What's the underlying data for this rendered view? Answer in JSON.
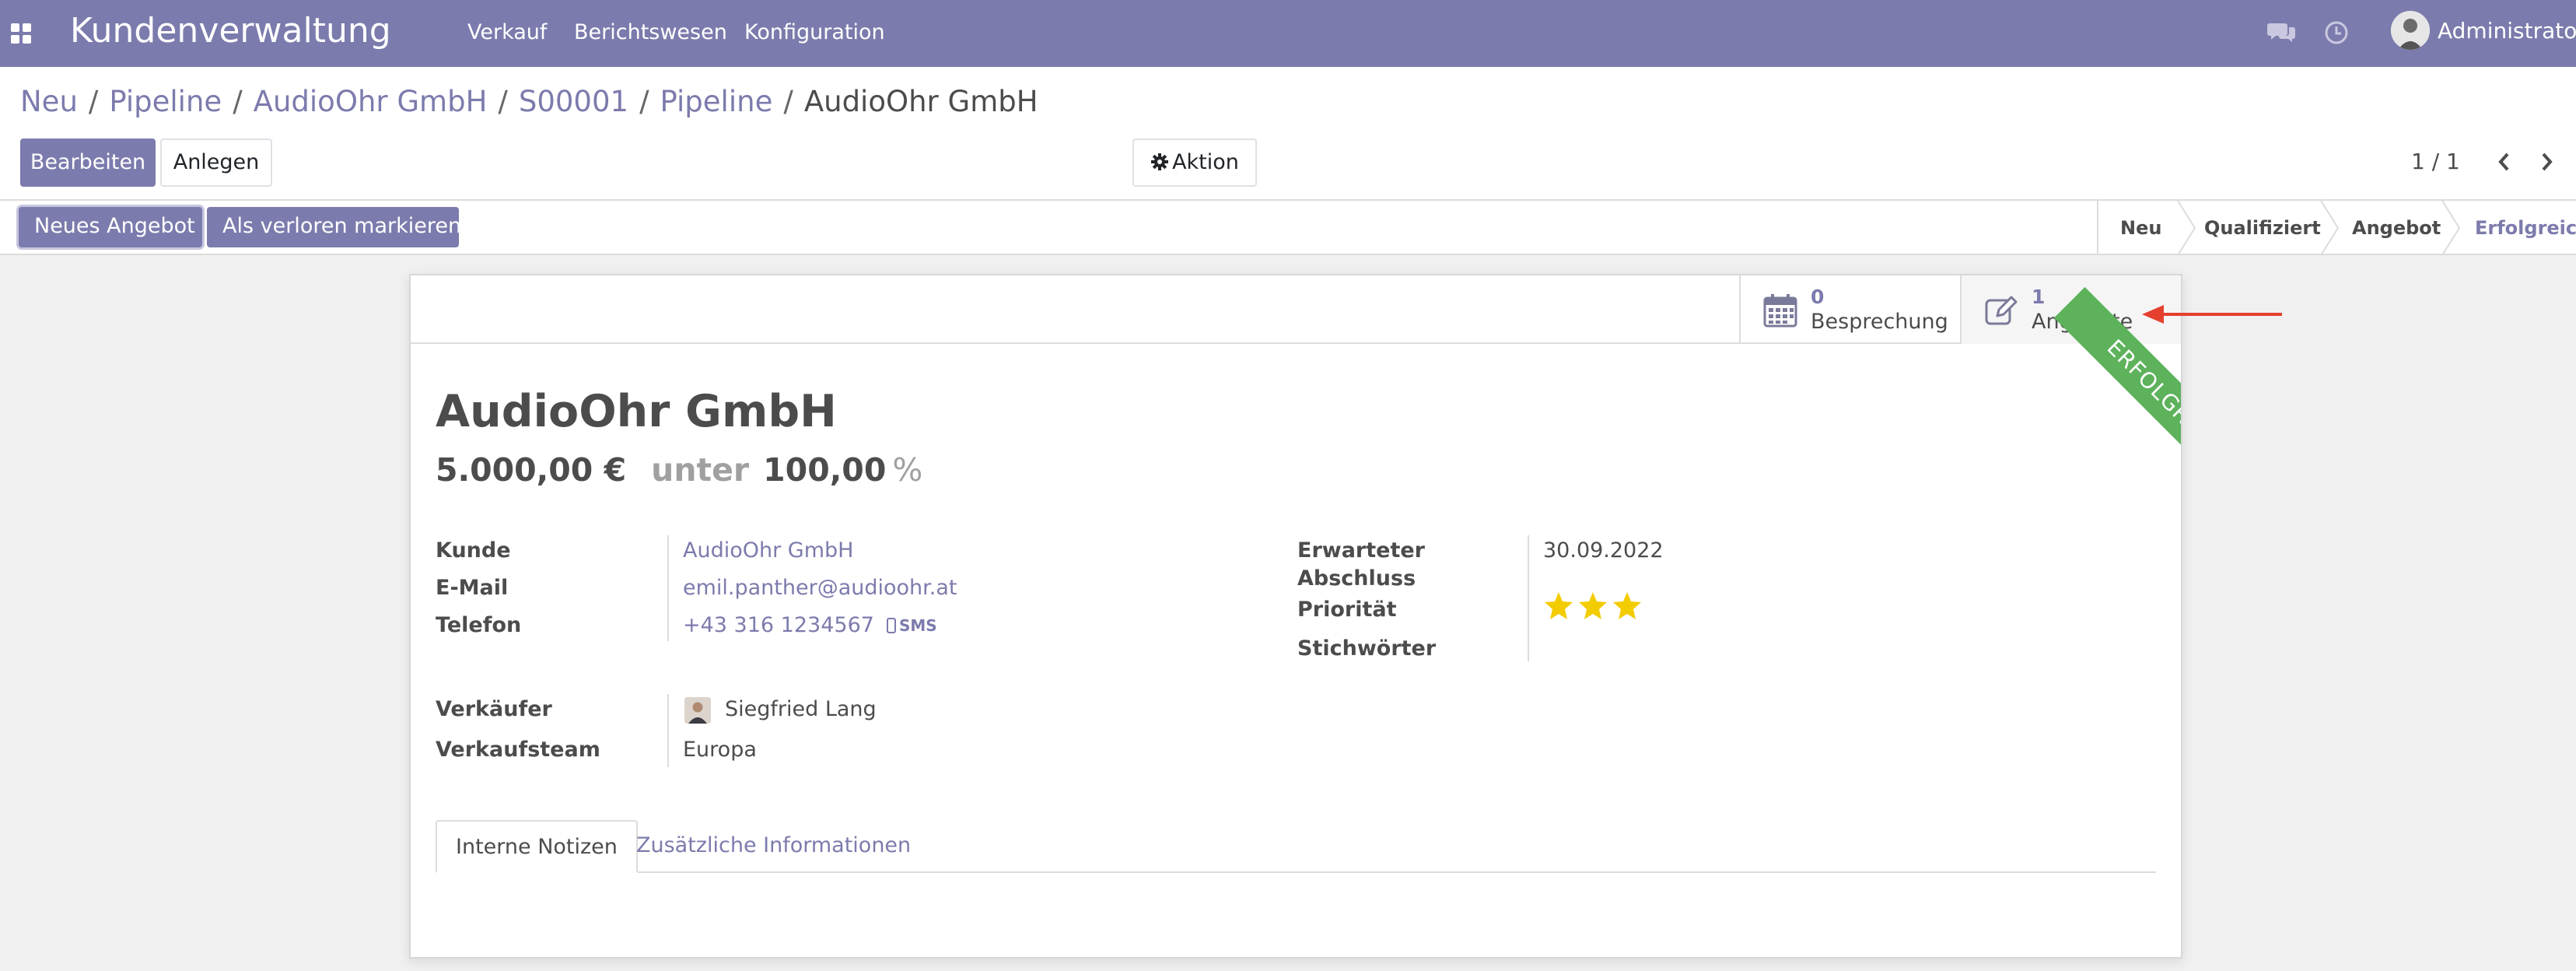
{
  "navbar": {
    "app_title": "Kundenverwaltung",
    "menu": [
      "Verkauf",
      "Berichtswesen",
      "Konfiguration"
    ],
    "user_name": "Administrator"
  },
  "breadcrumb": {
    "items": [
      "Neu",
      "Pipeline",
      "AudioOhr GmbH",
      "S00001",
      "Pipeline"
    ],
    "current": "AudioOhr GmbH",
    "separator": "/"
  },
  "toolbar": {
    "edit_label": "Bearbeiten",
    "create_label": "Anlegen",
    "action_label": "Aktion",
    "pager": "1 / 1"
  },
  "statusbar": {
    "new_quote_label": "Neues Angebot",
    "mark_lost_label": "Als verloren markieren",
    "stages": [
      {
        "label": "Neu",
        "active": false
      },
      {
        "label": "Qualifiziert",
        "active": false
      },
      {
        "label": "Angebot",
        "active": false
      },
      {
        "label": "Erfolgreich",
        "active": true
      }
    ]
  },
  "smart_buttons": {
    "meetings": {
      "count": "0",
      "label": "Besprechung"
    },
    "quotations": {
      "count": "1",
      "label": "Angebote"
    }
  },
  "ribbon": "ERFOLGREICH",
  "record": {
    "title": "AudioOhr GmbH",
    "expected_revenue": "5.000,00 €",
    "at_label": "unter",
    "probability": "100,00",
    "probability_unit": "%"
  },
  "fields_left": {
    "customer_label": "Kunde",
    "customer_value": "AudioOhr GmbH",
    "email_label": "E-Mail",
    "email_value": "emil.panther@audioohr.at",
    "phone_label": "Telefon",
    "phone_value": "+43 316 1234567",
    "sms_label": "SMS",
    "salesperson_label": "Verkäufer",
    "salesperson_value": "Siegfried Lang",
    "team_label": "Verkaufsteam",
    "team_value": "Europa"
  },
  "fields_right": {
    "expected_close_label_1": "Erwarteter",
    "expected_close_label_2": "Abschluss",
    "expected_close_value": "30.09.2022",
    "priority_label": "Priorität",
    "priority_stars": 3,
    "tags_label": "Stichwörter"
  },
  "tabs": [
    {
      "label": "Interne Notizen",
      "active": true
    },
    {
      "label": "Zusätzliche Informationen",
      "active": false
    }
  ],
  "colors": {
    "brand": "#7c7bad",
    "ribbon_success": "#5db25b",
    "star": "#f3cc00",
    "annotation_arrow": "#e53f2e"
  }
}
